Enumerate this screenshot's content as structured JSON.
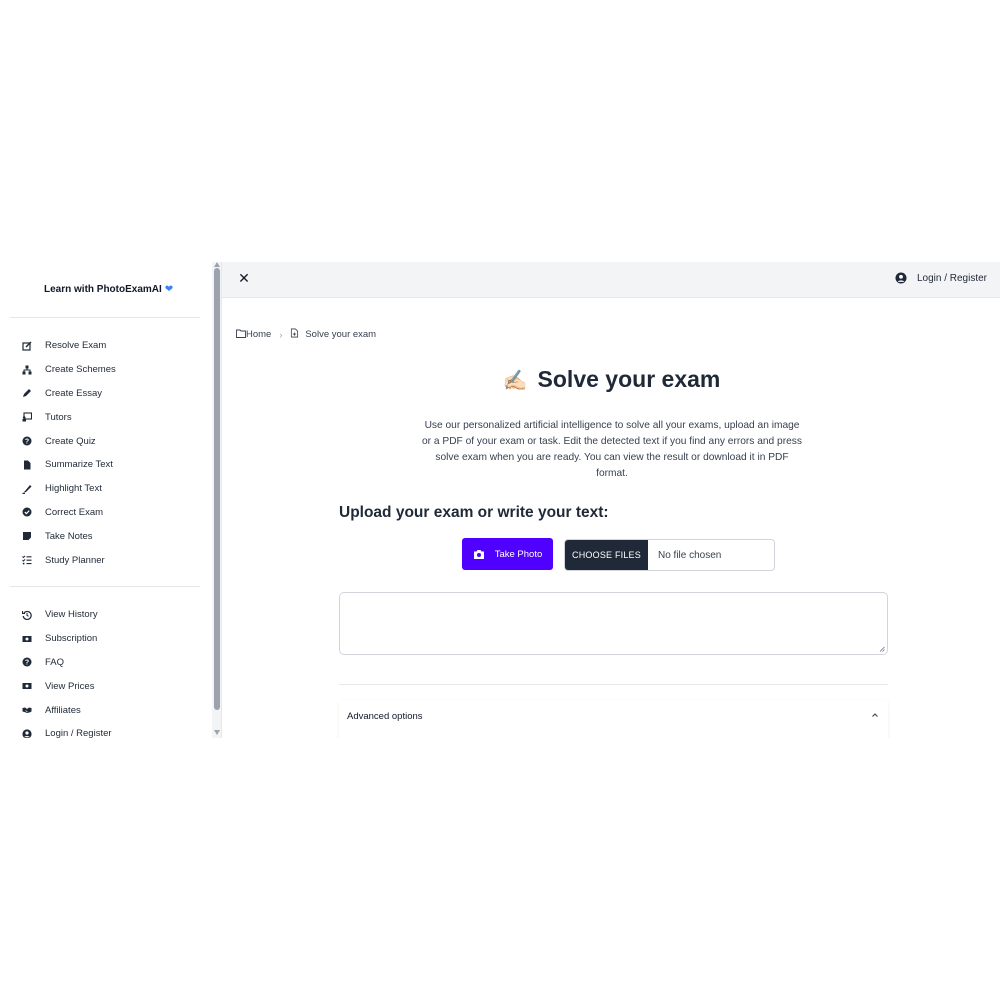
{
  "sidebar": {
    "brand": "Learn with PhotoExamAI",
    "brand_icon": "blue-heart-icon",
    "items": [
      {
        "label": "Resolve Exam",
        "icon": "edit-icon"
      },
      {
        "label": "Create Schemes",
        "icon": "sitemap-icon"
      },
      {
        "label": "Create Essay",
        "icon": "pencil-icon"
      },
      {
        "label": "Tutors",
        "icon": "chalkboard-teacher-icon"
      },
      {
        "label": "Create Quiz",
        "icon": "question-circle-icon"
      },
      {
        "label": "Summarize Text",
        "icon": "file-icon"
      },
      {
        "label": "Highlight Text",
        "icon": "highlighter-icon"
      },
      {
        "label": "Correct Exam",
        "icon": "check-circle-icon"
      },
      {
        "label": "Take Notes",
        "icon": "sticky-note-icon"
      },
      {
        "label": "Study Planner",
        "icon": "list-check-icon"
      }
    ],
    "secondary_items": [
      {
        "label": "View History",
        "icon": "history-icon"
      },
      {
        "label": "Subscription",
        "icon": "money-bill-icon"
      },
      {
        "label": "FAQ",
        "icon": "question-circle-icon"
      },
      {
        "label": "View Prices",
        "icon": "money-bill-icon"
      },
      {
        "label": "Affiliates",
        "icon": "handshake-icon"
      },
      {
        "label": "Login / Register",
        "icon": "user-circle-icon"
      }
    ]
  },
  "topbar": {
    "close_icon": "close-icon",
    "login_label": "Login / Register"
  },
  "breadcrumb": {
    "home": "Home",
    "current": "Solve your exam"
  },
  "main": {
    "title_emoji": "✍🏻",
    "title": "Solve your exam",
    "description": "Use our personalized artificial intelligence to solve all your exams, upload an image or a PDF of your exam or task. Edit the detected text if you find any errors and press solve exam when you are ready. You can view the result or download it in PDF format.",
    "section_title": "Upload your exam or write your text:",
    "take_photo_label": "Take Photo",
    "choose_files_label": "CHOOSE FILES",
    "file_status": "No file chosen",
    "textarea_value": "",
    "advanced_options_label": "Advanced options"
  },
  "colors": {
    "accent": "#4f00ff",
    "dark_button": "#1f2937",
    "topbar_bg": "#f3f4f6"
  }
}
